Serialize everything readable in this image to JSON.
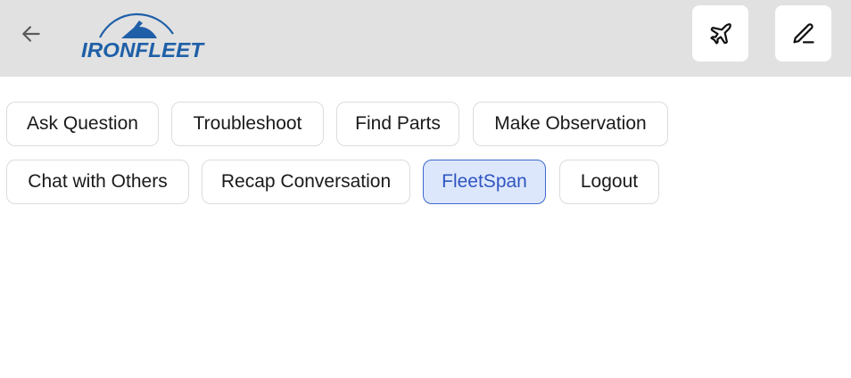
{
  "header": {
    "logo_text": "IRONFLEET",
    "back_icon": "arrow-left-icon",
    "actions": [
      {
        "name": "plane-icon"
      },
      {
        "name": "pencil-icon"
      }
    ]
  },
  "actions": {
    "row1": [
      "Ask Question",
      "Troubleshoot",
      "Find Parts",
      "Make Observation"
    ],
    "row2": [
      "Chat with Others",
      "Recap Conversation",
      "FleetSpan",
      "Logout"
    ],
    "active": "FleetSpan"
  },
  "colors": {
    "header_bg": "#e1e1e1",
    "brand_blue": "#1f5fa8",
    "active_bg": "#dde7fb",
    "active_border": "#3d68d0"
  }
}
